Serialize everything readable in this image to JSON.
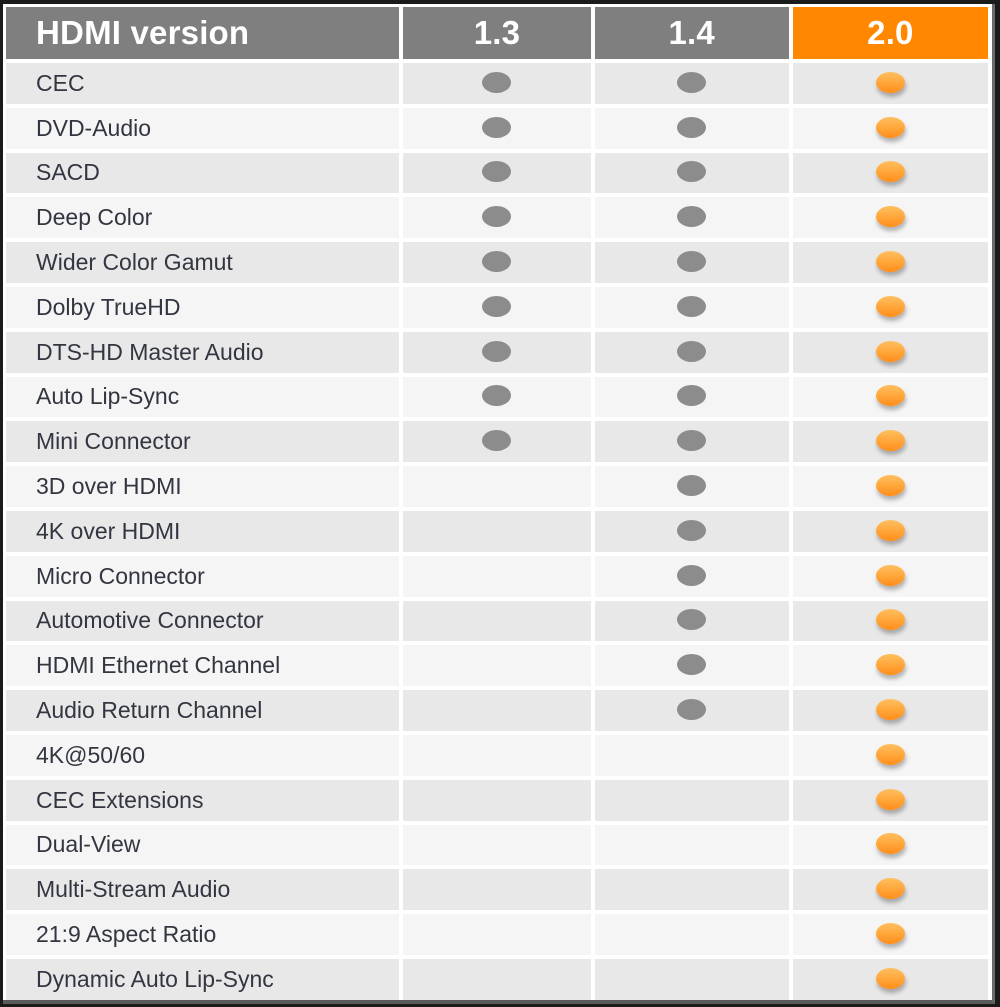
{
  "header": {
    "feature_label": "HDMI version",
    "versions": [
      "1.3",
      "1.4",
      "2.0"
    ]
  },
  "colors": {
    "header_gray": "#7f7f7f",
    "header_accent": "#ff8800",
    "dot_gray": "#8c8c8c",
    "dot_orange": "#ffa538",
    "row_dark": "#e8e8e8",
    "row_light": "#f5f5f5",
    "text": "#333640"
  },
  "icons": {
    "supported_legacy": "gray-dot-icon",
    "supported_current": "orange-dot-icon"
  },
  "rows": [
    {
      "feature": "CEC",
      "support": [
        true,
        true,
        true
      ]
    },
    {
      "feature": "DVD-Audio",
      "support": [
        true,
        true,
        true
      ]
    },
    {
      "feature": "SACD",
      "support": [
        true,
        true,
        true
      ]
    },
    {
      "feature": "Deep Color",
      "support": [
        true,
        true,
        true
      ]
    },
    {
      "feature": "Wider Color Gamut",
      "support": [
        true,
        true,
        true
      ]
    },
    {
      "feature": "Dolby TrueHD",
      "support": [
        true,
        true,
        true
      ]
    },
    {
      "feature": "DTS-HD Master Audio",
      "support": [
        true,
        true,
        true
      ]
    },
    {
      "feature": "Auto Lip-Sync",
      "support": [
        true,
        true,
        true
      ]
    },
    {
      "feature": "Mini Connector",
      "support": [
        true,
        true,
        true
      ]
    },
    {
      "feature": "3D over HDMI",
      "support": [
        false,
        true,
        true
      ]
    },
    {
      "feature": "4K over HDMI",
      "support": [
        false,
        true,
        true
      ]
    },
    {
      "feature": "Micro Connector",
      "support": [
        false,
        true,
        true
      ]
    },
    {
      "feature": "Automotive Connector",
      "support": [
        false,
        true,
        true
      ]
    },
    {
      "feature": "HDMI Ethernet Channel",
      "support": [
        false,
        true,
        true
      ]
    },
    {
      "feature": "Audio Return Channel",
      "support": [
        false,
        true,
        true
      ]
    },
    {
      "feature": "4K@50/60",
      "support": [
        false,
        false,
        true
      ]
    },
    {
      "feature": "CEC Extensions",
      "support": [
        false,
        false,
        true
      ]
    },
    {
      "feature": "Dual-View",
      "support": [
        false,
        false,
        true
      ]
    },
    {
      "feature": "Multi-Stream Audio",
      "support": [
        false,
        false,
        true
      ]
    },
    {
      "feature": "21:9 Aspect Ratio",
      "support": [
        false,
        false,
        true
      ]
    },
    {
      "feature": "Dynamic Auto Lip-Sync",
      "support": [
        false,
        false,
        true
      ]
    }
  ]
}
